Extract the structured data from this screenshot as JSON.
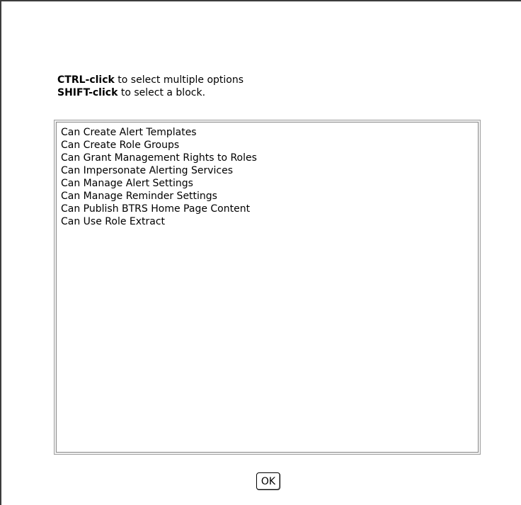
{
  "instructions": {
    "ctrl_key": "CTRL-click",
    "ctrl_text": " to select multiple options",
    "shift_key": "SHIFT-click",
    "shift_text": " to select a block."
  },
  "permissions_list": {
    "options": [
      "Can Create Alert Templates",
      "Can Create Role Groups",
      "Can Grant Management Rights to Roles",
      "Can Impersonate Alerting Services",
      "Can Manage Alert Settings",
      "Can Manage Reminder Settings",
      "Can Publish BTRS Home Page Content",
      "Can Use Role Extract"
    ]
  },
  "ok_button": {
    "label": "OK"
  }
}
